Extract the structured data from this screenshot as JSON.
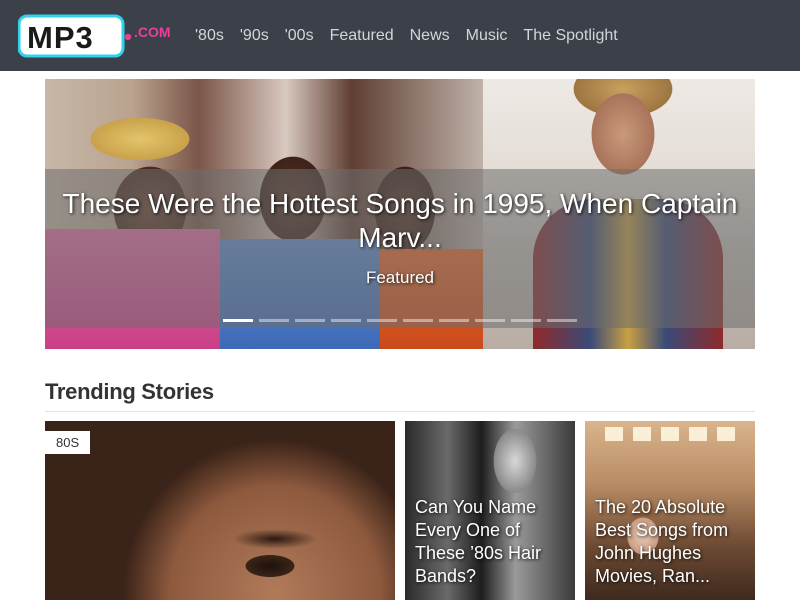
{
  "header": {
    "logo_text": "MP3",
    "logo_suffix": ".COM",
    "nav": [
      "'80s",
      "'90s",
      "'00s",
      "Featured",
      "News",
      "Music",
      "The Spotlight"
    ]
  },
  "hero": {
    "title": "These Were the Hottest Songs in 1995, When Captain Marv...",
    "category": "Featured",
    "slide_count": 10,
    "active_slide": 1
  },
  "trending": {
    "heading": "Trending Stories",
    "cards": [
      {
        "badge": "80S",
        "title": ""
      },
      {
        "title": "Can You Name Every One of These ’80s Hair Bands?"
      },
      {
        "title": "The 20 Absolute Best Songs from John Hughes Movies, Ran..."
      }
    ]
  },
  "colors": {
    "header_bg": "#3c4149",
    "logo_cyan": "#2ed3ea",
    "logo_pink": "#e8409a"
  }
}
